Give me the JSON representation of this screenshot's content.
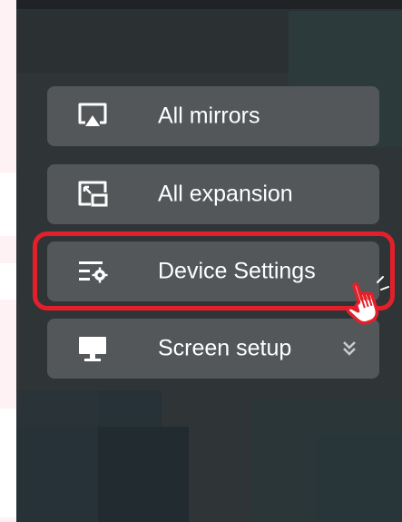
{
  "menu": {
    "items": [
      {
        "label": "All mirrors",
        "icon": "airplay-icon"
      },
      {
        "label": "All expansion",
        "icon": "expand-window-icon"
      },
      {
        "label": "Device Settings",
        "icon": "settings-list-icon",
        "highlighted": true
      },
      {
        "label": "Screen setup",
        "icon": "monitor-icon",
        "has_dropdown": true
      }
    ]
  },
  "colors": {
    "panel_bg": "#2f3437",
    "item_bg": "#535759",
    "highlight": "#e3202a",
    "text": "#ffffff"
  }
}
